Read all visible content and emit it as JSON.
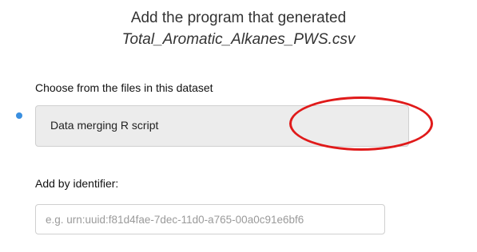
{
  "header": {
    "line1": "Add the program that generated",
    "line2": "Total_Aromatic_Alkanes_PWS.csv"
  },
  "choose_section": {
    "label": "Choose from the files in this dataset",
    "selected_option": "Data merging R script"
  },
  "identifier_section": {
    "label": "Add by identifier:",
    "placeholder": "e.g. urn:uuid:f81d4fae-7dec-11d0-a765-00a0c91e6bf6",
    "value": ""
  },
  "colors": {
    "radio_dot": "#3a8fe0",
    "annotation": "#e01a1a",
    "option_bg": "#ececec"
  }
}
